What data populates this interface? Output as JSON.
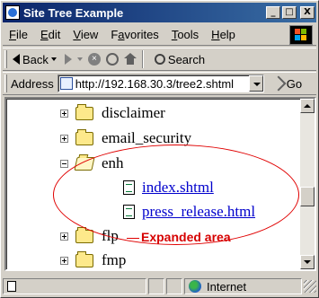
{
  "window": {
    "title": "Site Tree Example",
    "buttons": {
      "minimize": "_",
      "maximize": "□",
      "close": "X"
    }
  },
  "menu": {
    "items": [
      {
        "label": "File",
        "accel": "F",
        "rest": "ile"
      },
      {
        "label": "Edit",
        "accel": "E",
        "rest": "dit"
      },
      {
        "label": "View",
        "accel": "V",
        "rest": "iew"
      },
      {
        "label": "Favorites",
        "accel": "a",
        "pre": "F",
        "rest": "vorites"
      },
      {
        "label": "Tools",
        "accel": "T",
        "rest": "ools"
      },
      {
        "label": "Help",
        "accel": "H",
        "rest": "elp"
      }
    ]
  },
  "toolbar": {
    "back_label": "Back",
    "search_label": "Search"
  },
  "address": {
    "label": "Address",
    "url": "http://192.168.30.3/tree2.shtml",
    "go_label": "Go"
  },
  "tree": {
    "items": [
      {
        "label": "disclaimer",
        "type": "folder",
        "state": "collapsed"
      },
      {
        "label": "email_security",
        "type": "folder",
        "state": "collapsed"
      },
      {
        "label": "enh",
        "type": "folder",
        "state": "expanded"
      },
      {
        "label": "index.shtml",
        "type": "file",
        "link": true
      },
      {
        "label": "press_release.html",
        "type": "file",
        "link": true
      },
      {
        "label": "flp",
        "type": "folder",
        "state": "collapsed"
      },
      {
        "label": "fmp",
        "type": "folder",
        "state": "collapsed"
      }
    ]
  },
  "annotation": {
    "text": "Expanded area",
    "color": "#d60000"
  },
  "statusbar": {
    "zone": "Internet"
  },
  "colors": {
    "titlebar_start": "#0a246a",
    "titlebar_end": "#3a6ea5",
    "link": "#0000cc",
    "chrome": "#d4d0c8"
  }
}
